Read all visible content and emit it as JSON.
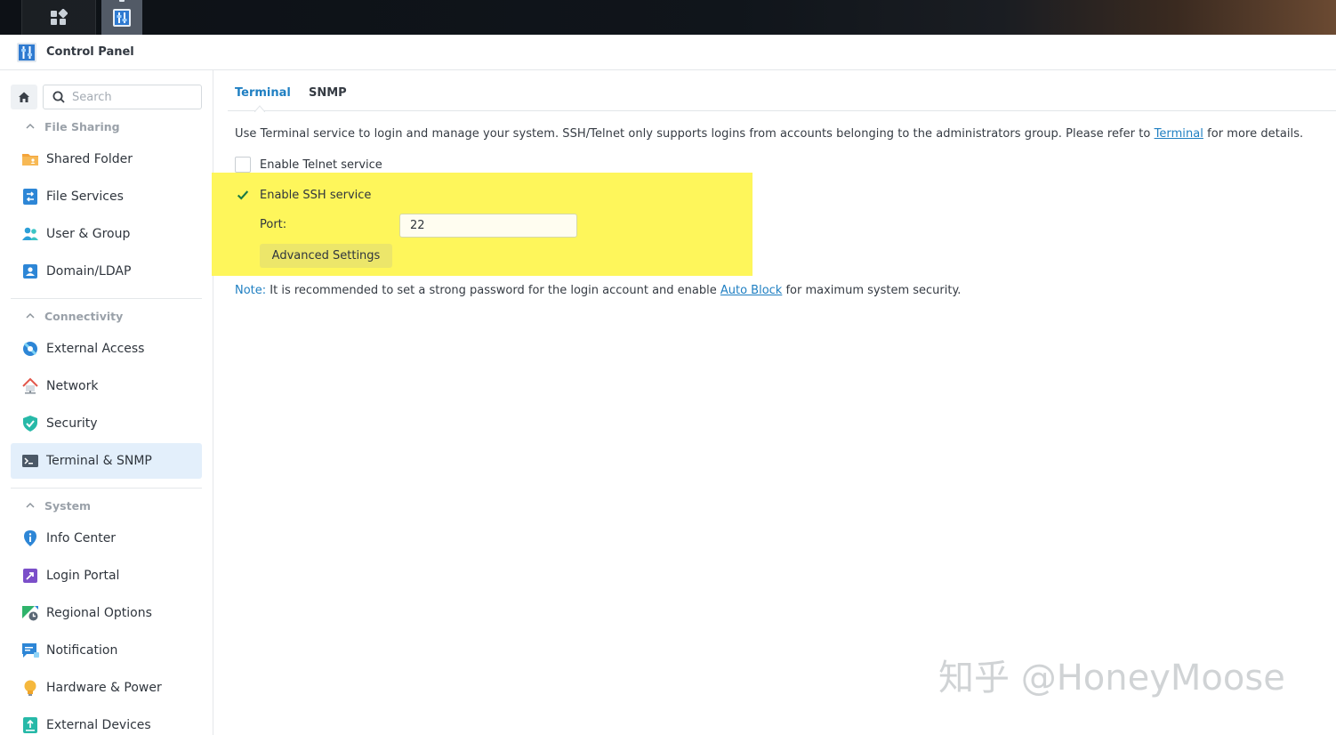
{
  "window": {
    "title": "Control Panel"
  },
  "search": {
    "placeholder": "Search"
  },
  "sidebar": {
    "groups": [
      {
        "label": "File Sharing",
        "items": [
          {
            "label": "Shared Folder",
            "icon": "shared-folder-icon"
          },
          {
            "label": "File Services",
            "icon": "file-services-icon"
          },
          {
            "label": "User & Group",
            "icon": "user-group-icon"
          },
          {
            "label": "Domain/LDAP",
            "icon": "domain-ldap-icon"
          }
        ]
      },
      {
        "label": "Connectivity",
        "items": [
          {
            "label": "External Access",
            "icon": "external-access-icon"
          },
          {
            "label": "Network",
            "icon": "network-icon"
          },
          {
            "label": "Security",
            "icon": "shield-icon"
          },
          {
            "label": "Terminal & SNMP",
            "icon": "terminal-icon",
            "active": true
          }
        ]
      },
      {
        "label": "System",
        "items": [
          {
            "label": "Info Center",
            "icon": "info-icon"
          },
          {
            "label": "Login Portal",
            "icon": "login-portal-icon"
          },
          {
            "label": "Regional Options",
            "icon": "regional-options-icon"
          },
          {
            "label": "Notification",
            "icon": "notification-icon"
          },
          {
            "label": "Hardware & Power",
            "icon": "lightbulb-icon"
          },
          {
            "label": "External Devices",
            "icon": "external-devices-icon"
          }
        ]
      }
    ]
  },
  "tabs": [
    {
      "label": "Terminal",
      "active": true
    },
    {
      "label": "SNMP"
    }
  ],
  "terminal": {
    "description_before": "Use Terminal service to login and manage your system. SSH/Telnet only supports logins from accounts belonging to the administrators group. Please refer to ",
    "description_link": "Terminal",
    "description_after": " for more details.",
    "telnet_label": "Enable Telnet service",
    "telnet_checked": false,
    "ssh_label": "Enable SSH service",
    "ssh_checked": true,
    "port_label": "Port:",
    "port_value": "22",
    "advanced_button": "Advanced Settings",
    "note_label": "Note:",
    "note_before": " It is recommended to set a strong password for the login account and enable ",
    "note_link": "Auto Block",
    "note_after": " for maximum system security."
  },
  "watermark": "知乎 @HoneyMoose",
  "colors": {
    "accent": "#1f7fc2",
    "highlight": "#fef65b",
    "active_bg": "#e3effb"
  }
}
